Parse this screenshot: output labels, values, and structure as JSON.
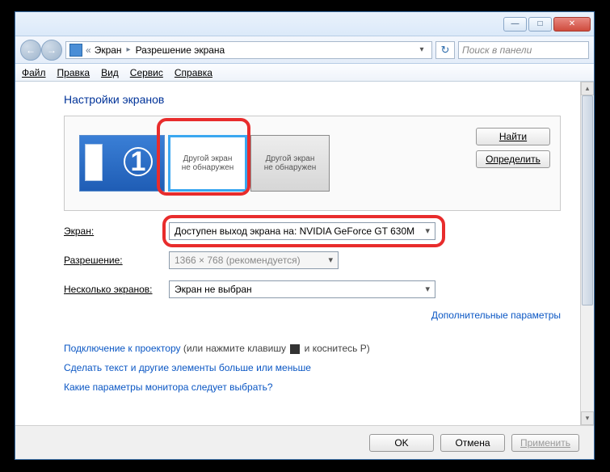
{
  "window_controls": {
    "min": "—",
    "max": "□",
    "close": "✕"
  },
  "nav": {
    "back": "←",
    "fwd": "→"
  },
  "address": {
    "prefix": "«",
    "crumb1": "Экран",
    "sep": "▸",
    "crumb2": "Разрешение экрана",
    "dropdown": "▾"
  },
  "refresh_icon": "↻",
  "search": {
    "placeholder": "Поиск в панели"
  },
  "menubar": {
    "file": "Файл",
    "edit": "Правка",
    "view": "Вид",
    "tools": "Сервис",
    "help": "Справка"
  },
  "heading": "Настройки экранов",
  "monitors": {
    "primary_number": "1",
    "not_detected_line1": "Другой экран",
    "not_detected_line2": "не обнаружен"
  },
  "buttons": {
    "find": "Найти",
    "detect": "Определить"
  },
  "rows": {
    "screen_label": "Экран:",
    "screen_value": "Доступен выход экрана на: NVIDIA GeForce GT 630M",
    "resolution_label": "Разрешение:",
    "resolution_value": "1366 × 768 (рекомендуется)",
    "multi_label": "Несколько экранов:",
    "multi_value": "Экран не выбран"
  },
  "adv_link": "Дополнительные параметры",
  "links": {
    "projector_link": "Подключение к проектору",
    "projector_hint": " (или нажмите клавишу ",
    "projector_hint2": " и коснитесь P)",
    "textsize": "Сделать текст и другие элементы больше или меньше",
    "which_monitor": "Какие параметры монитора следует выбрать?"
  },
  "footer": {
    "ok": "OK",
    "cancel": "Отмена",
    "apply": "Применить"
  }
}
